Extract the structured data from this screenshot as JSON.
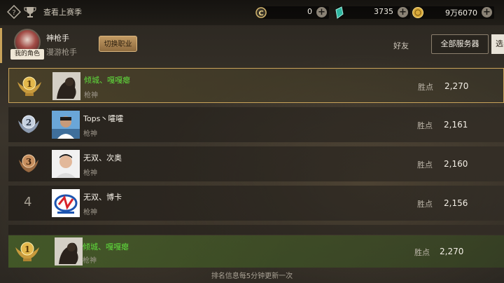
{
  "topbar": {
    "season_link": "查看上赛季",
    "currencies": [
      {
        "icon": "c-coin-icon",
        "amount": "0"
      },
      {
        "icon": "gem-icon",
        "amount": "3735"
      },
      {
        "icon": "gold-coin-icon",
        "amount": "9万6070"
      }
    ],
    "plus": "+"
  },
  "me": {
    "badge": "我的角色",
    "name": "神枪手",
    "class": "漫游枪手",
    "switch_label": "切换职业"
  },
  "tabs": {
    "friends": "好友",
    "all_servers": "全部服务器",
    "select": "选"
  },
  "points_label": "胜点",
  "rows": [
    {
      "rank": "1",
      "name": "倾城、嘎嘎瘪",
      "job": "枪神",
      "points": "2,270",
      "highlight": true
    },
    {
      "rank": "2",
      "name": "Tops丶嚯嚯",
      "job": "枪神",
      "points": "2,161",
      "highlight": false
    },
    {
      "rank": "3",
      "name": "无双、次奥",
      "job": "枪神",
      "points": "2,160",
      "highlight": false
    },
    {
      "rank": "4",
      "name": "无双、博卡",
      "job": "枪神",
      "points": "2,156",
      "highlight": false
    }
  ],
  "my_rank": {
    "rank": "1",
    "name": "倾城、嘎嘎瘪",
    "job": "枪神",
    "points": "2,270"
  },
  "footer": "排名信息每5分钟更新一次",
  "colors": {
    "gold": "#c9a35a",
    "green_name": "#5fdc3c",
    "self_row": "#4a6a2a"
  }
}
